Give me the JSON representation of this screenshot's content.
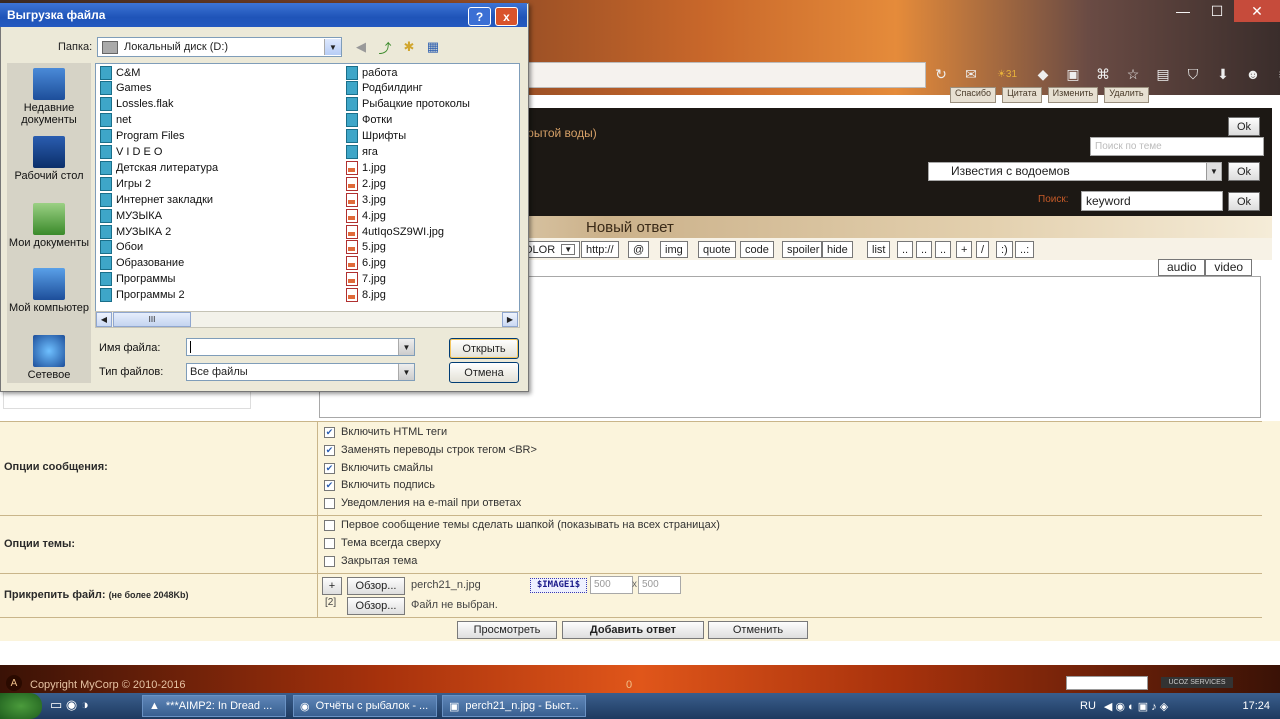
{
  "browser": {
    "weather_badge": "31",
    "toolbar_icons": [
      "refresh-icon",
      "mail-icon",
      "weather-icon",
      "fox-icon",
      "lock-icon",
      "screenshot-icon",
      "star-icon",
      "reader-icon",
      "pocket-icon",
      "download-icon",
      "smiley-icon",
      "menu-icon"
    ]
  },
  "post": {
    "buttons": [
      "Спасибо",
      "Цитата",
      "Изменить",
      "Удалить"
    ]
  },
  "forum": {
    "topic_fragment": "открытой воды)",
    "ok_label": "Ok",
    "theme_search_placeholder": "Поиск по теме",
    "forum_select_value": "Известия с водоемов",
    "search_label": "Поиск:",
    "search_value": "keyword",
    "reply_title": "Новый ответ"
  },
  "bbcodes": [
    "OLOR",
    "http://",
    "@",
    "img",
    "quote",
    "code",
    "spoiler",
    "hide",
    "list",
    "..",
    "..",
    "..",
    "+",
    "/",
    ":)",
    "..:"
  ],
  "media": [
    "audio",
    "video"
  ],
  "options": {
    "message_label": "Опции сообщения:",
    "message_items": [
      {
        "label": "Включить HTML теги",
        "checked": true
      },
      {
        "label": "Заменять переводы строк тегом <BR>",
        "checked": true
      },
      {
        "label": "Включить смайлы",
        "checked": true
      },
      {
        "label": "Включить подпись",
        "checked": true
      },
      {
        "label": "Уведомления на e-mail при ответах",
        "checked": false
      }
    ],
    "topic_label": "Опции темы:",
    "topic_items": [
      {
        "label": "Первое сообщение темы сделать шапкой (показывать на всех страницах)",
        "checked": false
      },
      {
        "label": "Тема всегда сверху",
        "checked": false
      },
      {
        "label": "Закрытая тема",
        "checked": false
      }
    ],
    "attach_label": "Прикрепить файл:",
    "attach_limit": "(не более 2048Kb)",
    "plus": "+",
    "browse": "Обзор...",
    "file1": "perch21_n.jpg",
    "image_tag": "$IMAGE1$",
    "w": "500",
    "x": "x",
    "h": "500",
    "idx2": "[2]",
    "file2": "Файл не выбран."
  },
  "actions": {
    "preview": "Просмотреть",
    "submit": "Добавить ответ",
    "cancel": "Отменить"
  },
  "footer": {
    "copyright": "Copyright MyCorp © 2010-2016",
    "counter": "0",
    "ucoz": "UCOZ SERVICES"
  },
  "taskbar": {
    "items": [
      "***AIMP2: In Dread ...",
      "Отчёты с рыбалок - ...",
      "perch21_n.jpg - Быст..."
    ],
    "lang": "RU",
    "time": "17:24"
  },
  "dialog": {
    "title": "Выгрузка файла",
    "help": "?",
    "close": "x",
    "folder_label": "Папка:",
    "folder_value": "Локальный диск (D:)",
    "places": [
      "Недавние документы",
      "Рабочий стол",
      "Мои документы",
      "Мой компьютер",
      "Сетевое"
    ],
    "col1": [
      {
        "name": "C&M",
        "type": "folder"
      },
      {
        "name": "Games",
        "type": "folder"
      },
      {
        "name": "Lossles.flak",
        "type": "folder"
      },
      {
        "name": "net",
        "type": "folder"
      },
      {
        "name": "Program Files",
        "type": "folder"
      },
      {
        "name": "V I D E O",
        "type": "folder"
      },
      {
        "name": "Детская литература",
        "type": "folder"
      },
      {
        "name": "Игры 2",
        "type": "folder"
      },
      {
        "name": "Интернет закладки",
        "type": "folder"
      },
      {
        "name": "МУЗЫКА",
        "type": "folder"
      },
      {
        "name": "МУЗЫКА 2",
        "type": "folder"
      },
      {
        "name": "Обои",
        "type": "folder"
      },
      {
        "name": "Образование",
        "type": "folder"
      },
      {
        "name": "Программы",
        "type": "folder"
      },
      {
        "name": "Программы 2",
        "type": "folder"
      }
    ],
    "col2": [
      {
        "name": "работа",
        "type": "folder"
      },
      {
        "name": "Родбилдинг",
        "type": "folder"
      },
      {
        "name": "Рыбацкие протоколы",
        "type": "folder"
      },
      {
        "name": "Фотки",
        "type": "folder"
      },
      {
        "name": "Шрифты",
        "type": "folder"
      },
      {
        "name": "яга",
        "type": "folder"
      },
      {
        "name": "1.jpg",
        "type": "jpg"
      },
      {
        "name": "2.jpg",
        "type": "jpg"
      },
      {
        "name": "3.jpg",
        "type": "jpg"
      },
      {
        "name": "4.jpg",
        "type": "jpg"
      },
      {
        "name": "4utIqoSZ9WI.jpg",
        "type": "jpg"
      },
      {
        "name": "5.jpg",
        "type": "jpg"
      },
      {
        "name": "6.jpg",
        "type": "jpg"
      },
      {
        "name": "7.jpg",
        "type": "jpg"
      },
      {
        "name": "8.jpg",
        "type": "jpg"
      }
    ],
    "scroll_thumb": "III",
    "filename_label": "Имя файла:",
    "filename_value": "",
    "filetype_label": "Тип файлов:",
    "filetype_value": "Все файлы",
    "open": "Открыть",
    "cancel": "Отмена"
  }
}
